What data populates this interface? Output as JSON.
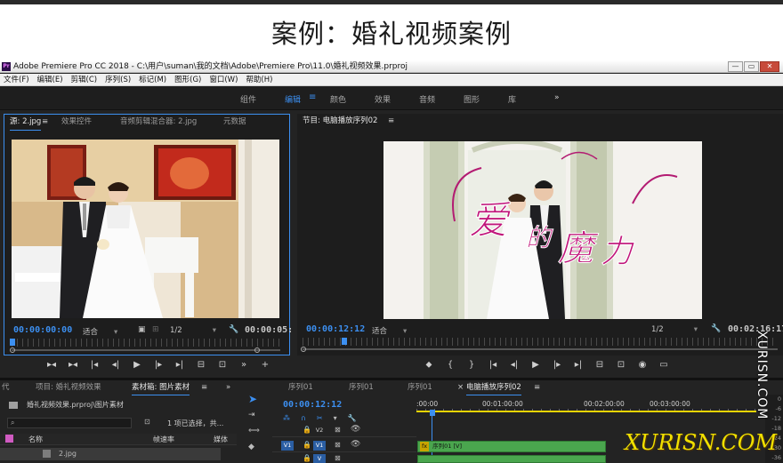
{
  "heading": "案例：婚礼视频案例",
  "app": {
    "logo": "Pr",
    "title": "Adobe Premiere Pro CC 2018 - C:\\用户\\suman\\我的文档\\Adobe\\Premiere Pro\\11.0\\婚礼视频效果.prproj",
    "window_buttons": [
      "—",
      "▭",
      "✕"
    ],
    "menu": [
      "文件(F)",
      "编辑(E)",
      "剪辑(C)",
      "序列(S)",
      "标记(M)",
      "图形(G)",
      "窗口(W)",
      "帮助(H)"
    ],
    "workspaces": [
      "组件",
      "编辑",
      "颜色",
      "效果",
      "音频",
      "图形",
      "库"
    ],
    "active_workspace": "编辑",
    "workspace_menu_icon": "≡",
    "workspace_more": "»"
  },
  "source_monitor": {
    "tabs": [
      "源: 2.jpg",
      "效果控件",
      "音频剪辑混合器: 2.jpg",
      "元数据"
    ],
    "tab_menu_icon": "≡",
    "timecode_in": "00:00:00:00",
    "fit": "适合",
    "resolution": "1/2",
    "timecode_out": "00:00:05:"
  },
  "program_monitor": {
    "title": "节目: 电脑播放序列02",
    "tab_menu_icon": "≡",
    "timecode_in": "00:00:12:12",
    "fit": "适合",
    "resolution": "1/2",
    "timecode_out": "00:02:16:17",
    "overlay_title": "爱的魔力"
  },
  "project_panel": {
    "tabs": [
      "代",
      "项目: 婚礼视频效果",
      "素材箱: 图片素材"
    ],
    "tab_menu_icon": "≡",
    "more": "»",
    "path": "婚礼视频效果.prproj\\图片素材",
    "selection_info": "1 项已选择，共...",
    "columns": [
      "名称",
      "帧速率",
      "媒体"
    ],
    "items": [
      {
        "name": "2.jpg"
      }
    ]
  },
  "timeline": {
    "tabs": [
      "序列01",
      "序列01",
      "序列01",
      "电脑播放序列02"
    ],
    "close_icon": "×",
    "tab_menu_icon": "≡",
    "timecode": "00:00:12:12",
    "ruler_labels": [
      ":00:00",
      "00:01:00:00",
      "00:02:00:00",
      "00:03:00:00"
    ],
    "tracks": [
      {
        "name": "V2"
      },
      {
        "name": "V1",
        "source": "V1"
      },
      {
        "name": "V"
      }
    ],
    "clip_label": "序列01 [V]",
    "clip_fx": "fx"
  },
  "meters": [
    "0",
    "-6",
    "-12",
    "-18",
    "-24",
    "-30",
    "-36"
  ],
  "watermark": {
    "vertical": "XURISN.COM",
    "horizontal": "XURISN.COM"
  }
}
